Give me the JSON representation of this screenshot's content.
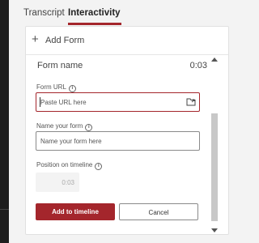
{
  "tabs": [
    {
      "label": "Transcript",
      "active": false
    },
    {
      "label": "Interactivity",
      "active": true
    }
  ],
  "add_form": {
    "label": "Add Form"
  },
  "form": {
    "name_label": "Form name",
    "time": "0:03",
    "url": {
      "label": "Form URL",
      "placeholder": "Paste URL here"
    },
    "name": {
      "label": "Name your form",
      "placeholder": "Name your form here"
    },
    "position": {
      "label": "Position on timeline",
      "value": "0:03"
    }
  },
  "buttons": {
    "add": "Add to timeline",
    "cancel": "Cancel"
  },
  "colors": {
    "accent": "#a4262c",
    "background": "#f3f3f3",
    "rail": "#1e1e1e"
  },
  "icons": {
    "info": "info-icon",
    "url_action": "open-folder-icon",
    "add": "plus-icon"
  }
}
